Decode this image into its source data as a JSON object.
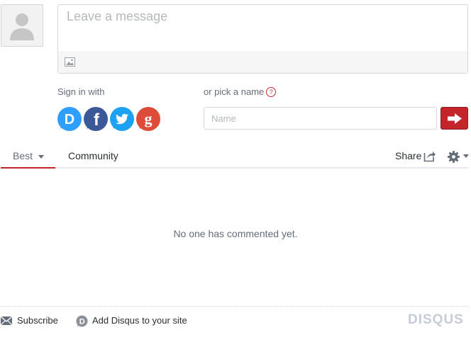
{
  "composer": {
    "placeholder": "Leave a message",
    "image_icon": "image-icon"
  },
  "auth": {
    "signin_label": "Sign in with",
    "pick_name_label": "or pick a name",
    "help_icon": "?",
    "providers": [
      {
        "name": "Disqus",
        "icon": "disqus-icon",
        "color": "#2e9fff"
      },
      {
        "name": "Facebook",
        "icon": "facebook-icon",
        "color": "#3b5998"
      },
      {
        "name": "Twitter",
        "icon": "twitter-icon",
        "color": "#1da1f2"
      },
      {
        "name": "Google",
        "icon": "google-icon",
        "color": "#dd4b39"
      }
    ],
    "name_placeholder": "Name",
    "submit_icon": "arrow-right-icon"
  },
  "tabs": {
    "best_label": "Best",
    "community_label": "Community",
    "share_label": "Share"
  },
  "main": {
    "empty_message": "No one has commented yet."
  },
  "footer": {
    "subscribe_label": "Subscribe",
    "add_disqus_label": "Add Disqus to your site",
    "logo_text": "DISQUS"
  },
  "colors": {
    "accent": "#c3252b",
    "text_muted": "#656c7a"
  }
}
